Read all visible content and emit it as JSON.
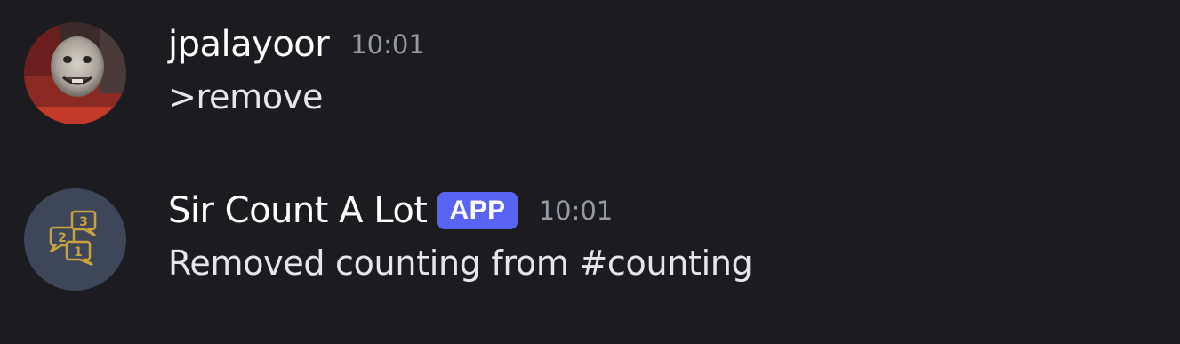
{
  "messages": [
    {
      "author": "jpalayoor",
      "timestamp": "10:01",
      "content": ">remove",
      "avatar_icon": "train-face-avatar"
    },
    {
      "author": "Sir Count A Lot",
      "badge": "APP",
      "timestamp": "10:01",
      "content": "Removed counting from #counting",
      "avatar_icon": "numbered-speech-bubbles-avatar",
      "avatar_numbers": [
        "3",
        "2",
        "1"
      ]
    }
  ],
  "colors": {
    "background": "#1b1b20",
    "badge": "#5865f2",
    "timestamp": "#949ba4",
    "bot_avatar_bg": "#3d4759",
    "bubble_gold": "#c9a23c"
  }
}
